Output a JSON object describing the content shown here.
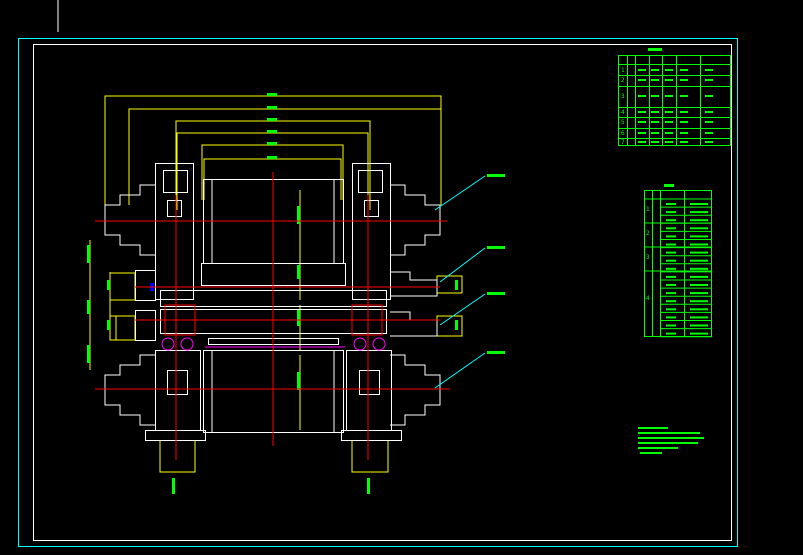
{
  "drawing": {
    "colors": {
      "background": "#000000",
      "frame": "#ffffff",
      "border": "#00ffff",
      "dimension": "#ffff00",
      "centerline": "#ff0000",
      "text": "#00ff00",
      "leader": "#00ffff"
    },
    "parts_table": {
      "row_numbers": [
        "1",
        "2",
        "3",
        "4",
        "5",
        "6",
        "7",
        "8"
      ]
    },
    "spec_table": {
      "group_numbers": [
        "1",
        "2",
        "3",
        "4"
      ]
    }
  }
}
